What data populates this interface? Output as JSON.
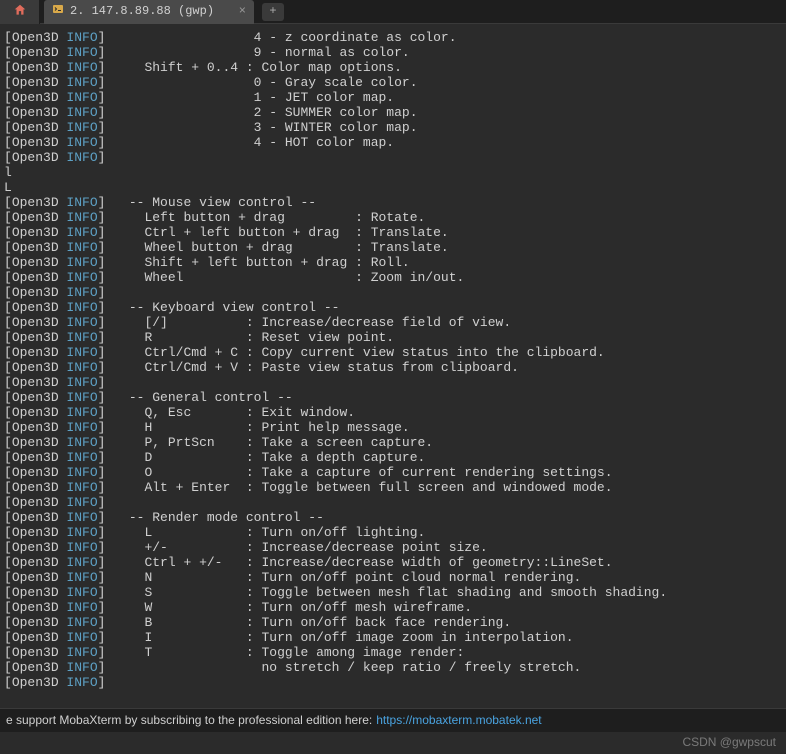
{
  "tab": {
    "title": "2. 147.8.89.88 (gwp)",
    "close": "×",
    "newtab": "+"
  },
  "lines": [
    {
      "tag": "[Open3D INFO] ",
      "text": "                  4 - z coordinate as color."
    },
    {
      "tag": "[Open3D INFO] ",
      "text": "                  9 - normal as color."
    },
    {
      "tag": "[Open3D INFO] ",
      "text": "    Shift + 0..4 : Color map options."
    },
    {
      "tag": "[Open3D INFO] ",
      "text": "                  0 - Gray scale color."
    },
    {
      "tag": "[Open3D INFO] ",
      "text": "                  1 - JET color map."
    },
    {
      "tag": "[Open3D INFO] ",
      "text": "                  2 - SUMMER color map."
    },
    {
      "tag": "[Open3D INFO] ",
      "text": "                  3 - WINTER color map."
    },
    {
      "tag": "[Open3D INFO] ",
      "text": "                  4 - HOT color map."
    },
    {
      "tag": "[Open3D INFO] ",
      "text": ""
    },
    {
      "tag": "",
      "text": "l"
    },
    {
      "tag": "",
      "text": "L"
    },
    {
      "tag": "[Open3D INFO] ",
      "text": "  -- Mouse view control --"
    },
    {
      "tag": "[Open3D INFO] ",
      "text": "    Left button + drag         : Rotate."
    },
    {
      "tag": "[Open3D INFO] ",
      "text": "    Ctrl + left button + drag  : Translate."
    },
    {
      "tag": "[Open3D INFO] ",
      "text": "    Wheel button + drag        : Translate."
    },
    {
      "tag": "[Open3D INFO] ",
      "text": "    Shift + left button + drag : Roll."
    },
    {
      "tag": "[Open3D INFO] ",
      "text": "    Wheel                      : Zoom in/out."
    },
    {
      "tag": "[Open3D INFO] ",
      "text": ""
    },
    {
      "tag": "[Open3D INFO] ",
      "text": "  -- Keyboard view control --"
    },
    {
      "tag": "[Open3D INFO] ",
      "text": "    [/]          : Increase/decrease field of view."
    },
    {
      "tag": "[Open3D INFO] ",
      "text": "    R            : Reset view point."
    },
    {
      "tag": "[Open3D INFO] ",
      "text": "    Ctrl/Cmd + C : Copy current view status into the clipboard."
    },
    {
      "tag": "[Open3D INFO] ",
      "text": "    Ctrl/Cmd + V : Paste view status from clipboard."
    },
    {
      "tag": "[Open3D INFO] ",
      "text": ""
    },
    {
      "tag": "[Open3D INFO] ",
      "text": "  -- General control --"
    },
    {
      "tag": "[Open3D INFO] ",
      "text": "    Q, Esc       : Exit window."
    },
    {
      "tag": "[Open3D INFO] ",
      "text": "    H            : Print help message."
    },
    {
      "tag": "[Open3D INFO] ",
      "text": "    P, PrtScn    : Take a screen capture."
    },
    {
      "tag": "[Open3D INFO] ",
      "text": "    D            : Take a depth capture."
    },
    {
      "tag": "[Open3D INFO] ",
      "text": "    O            : Take a capture of current rendering settings."
    },
    {
      "tag": "[Open3D INFO] ",
      "text": "    Alt + Enter  : Toggle between full screen and windowed mode."
    },
    {
      "tag": "[Open3D INFO] ",
      "text": ""
    },
    {
      "tag": "[Open3D INFO] ",
      "text": "  -- Render mode control --"
    },
    {
      "tag": "[Open3D INFO] ",
      "text": "    L            : Turn on/off lighting."
    },
    {
      "tag": "[Open3D INFO] ",
      "text": "    +/-          : Increase/decrease point size."
    },
    {
      "tag": "[Open3D INFO] ",
      "text": "    Ctrl + +/-   : Increase/decrease width of geometry::LineSet."
    },
    {
      "tag": "[Open3D INFO] ",
      "text": "    N            : Turn on/off point cloud normal rendering."
    },
    {
      "tag": "[Open3D INFO] ",
      "text": "    S            : Toggle between mesh flat shading and smooth shading."
    },
    {
      "tag": "[Open3D INFO] ",
      "text": "    W            : Turn on/off mesh wireframe."
    },
    {
      "tag": "[Open3D INFO] ",
      "text": "    B            : Turn on/off back face rendering."
    },
    {
      "tag": "[Open3D INFO] ",
      "text": "    I            : Turn on/off image zoom in interpolation."
    },
    {
      "tag": "[Open3D INFO] ",
      "text": "    T            : Toggle among image render:"
    },
    {
      "tag": "[Open3D INFO] ",
      "text": "                   no stretch / keep ratio / freely stretch."
    },
    {
      "tag": "[Open3D INFO] ",
      "text": ""
    }
  ],
  "footer": {
    "text": "e support MobaXterm by subscribing to the professional edition here:  ",
    "link": "https://mobaxterm.mobatek.net"
  },
  "watermark": "CSDN @gwpscut"
}
